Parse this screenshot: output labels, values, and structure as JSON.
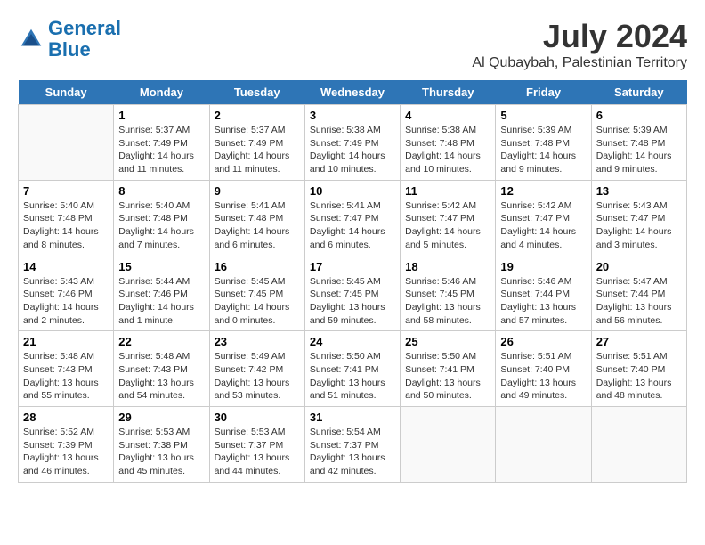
{
  "header": {
    "logo_line1": "General",
    "logo_line2": "Blue",
    "month": "July 2024",
    "location": "Al Qubaybah, Palestinian Territory"
  },
  "weekdays": [
    "Sunday",
    "Monday",
    "Tuesday",
    "Wednesday",
    "Thursday",
    "Friday",
    "Saturday"
  ],
  "weeks": [
    [
      {
        "day": "",
        "sunrise": "",
        "sunset": "",
        "daylight": ""
      },
      {
        "day": "1",
        "sunrise": "Sunrise: 5:37 AM",
        "sunset": "Sunset: 7:49 PM",
        "daylight": "Daylight: 14 hours and 11 minutes."
      },
      {
        "day": "2",
        "sunrise": "Sunrise: 5:37 AM",
        "sunset": "Sunset: 7:49 PM",
        "daylight": "Daylight: 14 hours and 11 minutes."
      },
      {
        "day": "3",
        "sunrise": "Sunrise: 5:38 AM",
        "sunset": "Sunset: 7:49 PM",
        "daylight": "Daylight: 14 hours and 10 minutes."
      },
      {
        "day": "4",
        "sunrise": "Sunrise: 5:38 AM",
        "sunset": "Sunset: 7:48 PM",
        "daylight": "Daylight: 14 hours and 10 minutes."
      },
      {
        "day": "5",
        "sunrise": "Sunrise: 5:39 AM",
        "sunset": "Sunset: 7:48 PM",
        "daylight": "Daylight: 14 hours and 9 minutes."
      },
      {
        "day": "6",
        "sunrise": "Sunrise: 5:39 AM",
        "sunset": "Sunset: 7:48 PM",
        "daylight": "Daylight: 14 hours and 9 minutes."
      }
    ],
    [
      {
        "day": "7",
        "sunrise": "Sunrise: 5:40 AM",
        "sunset": "Sunset: 7:48 PM",
        "daylight": "Daylight: 14 hours and 8 minutes."
      },
      {
        "day": "8",
        "sunrise": "Sunrise: 5:40 AM",
        "sunset": "Sunset: 7:48 PM",
        "daylight": "Daylight: 14 hours and 7 minutes."
      },
      {
        "day": "9",
        "sunrise": "Sunrise: 5:41 AM",
        "sunset": "Sunset: 7:48 PM",
        "daylight": "Daylight: 14 hours and 6 minutes."
      },
      {
        "day": "10",
        "sunrise": "Sunrise: 5:41 AM",
        "sunset": "Sunset: 7:47 PM",
        "daylight": "Daylight: 14 hours and 6 minutes."
      },
      {
        "day": "11",
        "sunrise": "Sunrise: 5:42 AM",
        "sunset": "Sunset: 7:47 PM",
        "daylight": "Daylight: 14 hours and 5 minutes."
      },
      {
        "day": "12",
        "sunrise": "Sunrise: 5:42 AM",
        "sunset": "Sunset: 7:47 PM",
        "daylight": "Daylight: 14 hours and 4 minutes."
      },
      {
        "day": "13",
        "sunrise": "Sunrise: 5:43 AM",
        "sunset": "Sunset: 7:47 PM",
        "daylight": "Daylight: 14 hours and 3 minutes."
      }
    ],
    [
      {
        "day": "14",
        "sunrise": "Sunrise: 5:43 AM",
        "sunset": "Sunset: 7:46 PM",
        "daylight": "Daylight: 14 hours and 2 minutes."
      },
      {
        "day": "15",
        "sunrise": "Sunrise: 5:44 AM",
        "sunset": "Sunset: 7:46 PM",
        "daylight": "Daylight: 14 hours and 1 minute."
      },
      {
        "day": "16",
        "sunrise": "Sunrise: 5:45 AM",
        "sunset": "Sunset: 7:45 PM",
        "daylight": "Daylight: 14 hours and 0 minutes."
      },
      {
        "day": "17",
        "sunrise": "Sunrise: 5:45 AM",
        "sunset": "Sunset: 7:45 PM",
        "daylight": "Daylight: 13 hours and 59 minutes."
      },
      {
        "day": "18",
        "sunrise": "Sunrise: 5:46 AM",
        "sunset": "Sunset: 7:45 PM",
        "daylight": "Daylight: 13 hours and 58 minutes."
      },
      {
        "day": "19",
        "sunrise": "Sunrise: 5:46 AM",
        "sunset": "Sunset: 7:44 PM",
        "daylight": "Daylight: 13 hours and 57 minutes."
      },
      {
        "day": "20",
        "sunrise": "Sunrise: 5:47 AM",
        "sunset": "Sunset: 7:44 PM",
        "daylight": "Daylight: 13 hours and 56 minutes."
      }
    ],
    [
      {
        "day": "21",
        "sunrise": "Sunrise: 5:48 AM",
        "sunset": "Sunset: 7:43 PM",
        "daylight": "Daylight: 13 hours and 55 minutes."
      },
      {
        "day": "22",
        "sunrise": "Sunrise: 5:48 AM",
        "sunset": "Sunset: 7:43 PM",
        "daylight": "Daylight: 13 hours and 54 minutes."
      },
      {
        "day": "23",
        "sunrise": "Sunrise: 5:49 AM",
        "sunset": "Sunset: 7:42 PM",
        "daylight": "Daylight: 13 hours and 53 minutes."
      },
      {
        "day": "24",
        "sunrise": "Sunrise: 5:50 AM",
        "sunset": "Sunset: 7:41 PM",
        "daylight": "Daylight: 13 hours and 51 minutes."
      },
      {
        "day": "25",
        "sunrise": "Sunrise: 5:50 AM",
        "sunset": "Sunset: 7:41 PM",
        "daylight": "Daylight: 13 hours and 50 minutes."
      },
      {
        "day": "26",
        "sunrise": "Sunrise: 5:51 AM",
        "sunset": "Sunset: 7:40 PM",
        "daylight": "Daylight: 13 hours and 49 minutes."
      },
      {
        "day": "27",
        "sunrise": "Sunrise: 5:51 AM",
        "sunset": "Sunset: 7:40 PM",
        "daylight": "Daylight: 13 hours and 48 minutes."
      }
    ],
    [
      {
        "day": "28",
        "sunrise": "Sunrise: 5:52 AM",
        "sunset": "Sunset: 7:39 PM",
        "daylight": "Daylight: 13 hours and 46 minutes."
      },
      {
        "day": "29",
        "sunrise": "Sunrise: 5:53 AM",
        "sunset": "Sunset: 7:38 PM",
        "daylight": "Daylight: 13 hours and 45 minutes."
      },
      {
        "day": "30",
        "sunrise": "Sunrise: 5:53 AM",
        "sunset": "Sunset: 7:37 PM",
        "daylight": "Daylight: 13 hours and 44 minutes."
      },
      {
        "day": "31",
        "sunrise": "Sunrise: 5:54 AM",
        "sunset": "Sunset: 7:37 PM",
        "daylight": "Daylight: 13 hours and 42 minutes."
      },
      {
        "day": "",
        "sunrise": "",
        "sunset": "",
        "daylight": ""
      },
      {
        "day": "",
        "sunrise": "",
        "sunset": "",
        "daylight": ""
      },
      {
        "day": "",
        "sunrise": "",
        "sunset": "",
        "daylight": ""
      }
    ]
  ]
}
